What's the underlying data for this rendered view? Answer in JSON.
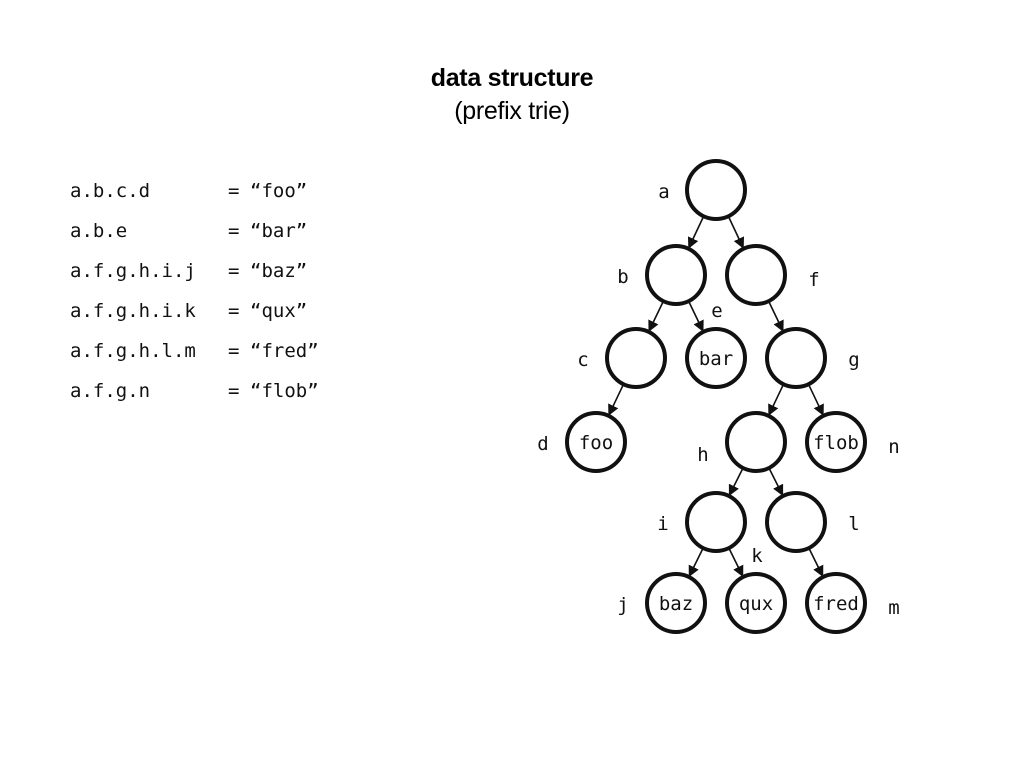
{
  "header": {
    "title": "data structure",
    "subtitle": "(prefix trie)"
  },
  "entries": [
    {
      "key": "a.b.c.d",
      "eq": "=",
      "value": "“foo”"
    },
    {
      "key": "a.b.e",
      "eq": "=",
      "value": "“bar”"
    },
    {
      "key": "a.f.g.h.i.j",
      "eq": "=",
      "value": "“baz”"
    },
    {
      "key": "a.f.g.h.i.k",
      "eq": "=",
      "value": "“qux”"
    },
    {
      "key": "a.f.g.h.l.m",
      "eq": "=",
      "value": "“fred”"
    },
    {
      "key": "a.f.g.n",
      "eq": "=",
      "value": "“flob”"
    }
  ],
  "trie": {
    "nodes": [
      {
        "id": "a",
        "label": "a",
        "value": "",
        "parent": null,
        "depth": 0,
        "slot": 0,
        "label_side": "left"
      },
      {
        "id": "b",
        "label": "b",
        "value": "",
        "parent": "a",
        "depth": 1,
        "slot": -1,
        "label_side": "left"
      },
      {
        "id": "f",
        "label": "f",
        "value": "",
        "parent": "a",
        "depth": 1,
        "slot": 1,
        "label_side": "right"
      },
      {
        "id": "c",
        "label": "c",
        "value": "",
        "parent": "b",
        "depth": 2,
        "slot": -2,
        "label_side": "left"
      },
      {
        "id": "e",
        "label": "e",
        "value": "bar",
        "parent": "b",
        "depth": 2,
        "slot": 0,
        "label_side": "top-right"
      },
      {
        "id": "g",
        "label": "g",
        "value": "",
        "parent": "f",
        "depth": 2,
        "slot": 2,
        "label_side": "right"
      },
      {
        "id": "d",
        "label": "d",
        "value": "foo",
        "parent": "c",
        "depth": 3,
        "slot": -3,
        "label_side": "left"
      },
      {
        "id": "h",
        "label": "h",
        "value": "",
        "parent": "g",
        "depth": 3,
        "slot": 1,
        "label_side": "left"
      },
      {
        "id": "n",
        "label": "n",
        "value": "flob",
        "parent": "g",
        "depth": 3,
        "slot": 3,
        "label_side": "right"
      },
      {
        "id": "i",
        "label": "i",
        "value": "",
        "parent": "h",
        "depth": 4,
        "slot": 0,
        "label_side": "left"
      },
      {
        "id": "l",
        "label": "l",
        "value": "",
        "parent": "h",
        "depth": 4,
        "slot": 2,
        "label_side": "right"
      },
      {
        "id": "j",
        "label": "j",
        "value": "baz",
        "parent": "i",
        "depth": 5,
        "slot": -1,
        "label_side": "left"
      },
      {
        "id": "k",
        "label": "k",
        "value": "qux",
        "parent": "i",
        "depth": 5,
        "slot": 1,
        "label_side": "top-right"
      },
      {
        "id": "m",
        "label": "m",
        "value": "fred",
        "parent": "l",
        "depth": 5,
        "slot": 3,
        "label_side": "right"
      }
    ]
  }
}
